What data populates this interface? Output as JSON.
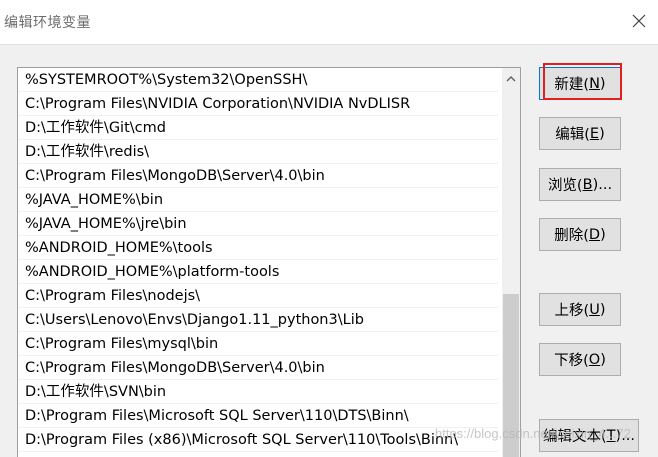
{
  "window": {
    "title": "编辑环境变量"
  },
  "path_entries": [
    "%SYSTEMROOT%\\System32\\OpenSSH\\",
    "C:\\Program Files\\NVIDIA Corporation\\NVIDIA NvDLISR",
    "D:\\工作软件\\Git\\cmd",
    "D:\\工作软件\\redis\\",
    "C:\\Program Files\\MongoDB\\Server\\4.0\\bin",
    "%JAVA_HOME%\\bin",
    "%JAVA_HOME%\\jre\\bin",
    "%ANDROID_HOME%\\tools",
    "%ANDROID_HOME%\\platform-tools",
    "C:\\Program Files\\nodejs\\",
    "C:\\Users\\Lenovo\\Envs\\Django1.11_python3\\Lib",
    "C:\\Program Files\\mysql\\bin",
    "C:\\Program Files\\MongoDB\\Server\\4.0\\bin",
    "D:\\工作软件\\SVN\\bin",
    "D:\\Program Files\\Microsoft SQL Server\\110\\DTS\\Binn\\",
    "D:\\Program Files (x86)\\Microsoft SQL Server\\110\\Tools\\Binn\\"
  ],
  "buttons": {
    "new": {
      "label": "新建(",
      "key": "N",
      "suffix": ")"
    },
    "edit": {
      "label": "编辑(",
      "key": "E",
      "suffix": ")"
    },
    "browse": {
      "label": "浏览(",
      "key": "B",
      "suffix": ")..."
    },
    "delete": {
      "label": "删除(",
      "key": "D",
      "suffix": ")"
    },
    "move_up": {
      "label": "上移(",
      "key": "U",
      "suffix": ")"
    },
    "move_down": {
      "label": "下移(",
      "key": "O",
      "suffix": ")"
    },
    "edit_text": {
      "label": "编辑文本(",
      "key": "T",
      "suffix": ")..."
    }
  },
  "watermark": "https://blog.csdn.net/weixin_4...72",
  "colors": {
    "highlight": "#e02020",
    "focus_border": "#0078d7"
  }
}
